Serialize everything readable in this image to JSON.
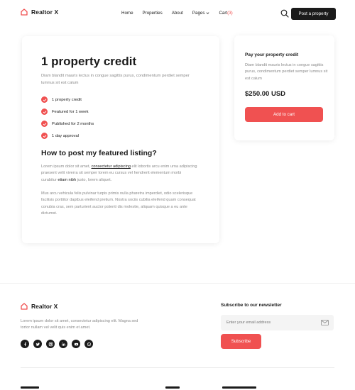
{
  "header": {
    "logo_text": "Realtor X",
    "nav": [
      "Home",
      "Properties",
      "About",
      "Pages"
    ],
    "cart_label": "Cart",
    "cart_count": "(3)",
    "cta": "Post a property"
  },
  "main": {
    "title": "1 property credit",
    "description": "Diam blandit mauris lectus in congue sagittis purus, condimentum  perdiet semper lumnus sit est calum",
    "features": [
      "1 property credit",
      "Featured for 1 week",
      "Published for 2 months",
      "1 day approval"
    ],
    "how_title": "How to post my featured listing?",
    "para1_a": "Lorem ipsum dolor sit amet, ",
    "para1_link": "consectetur adipiscing",
    "para1_b": " elit lobortis arcu enim urna adipiscing praesent velit viverra sit semper lorem eu cursus vel hendrerit elementum morbi curabitur ",
    "para1_strong": "etiam nibh",
    "para1_c": " justo, lorem aliquet.",
    "para2": "Mus arcu vehicula felis pulvinar turpis primis nulla pharetra imperdiet, odio scelerisque facilisis porttitor dapibus eleifend pretium. Nostra sociis cubilia eleifend quam consequat conubia cras, sem parturient auctor potenti dis molestie, aliquam quisque a eu ante dictumst."
  },
  "side": {
    "title": "Pay your property credit",
    "description": "Diam blandit mauris lectus in congue sagittis purus, condimentum  perdiet semper lumnus sit est calum",
    "price": "$250.00 USD",
    "button": "Add to cart"
  },
  "footer": {
    "logo_text": "Realtor X",
    "description": "Lorem ipsum dolor sit amet, consectetur adipiscing elit. Magna sed tortor nullam vel velit quis enim et amet.",
    "socials": [
      "facebook-icon",
      "twitter-icon",
      "instagram-icon",
      "linkedin-icon",
      "youtube-icon",
      "whatsapp-icon"
    ],
    "newsletter_title": "Subscribe to our newsletter",
    "email_placeholder": "Enter your email address",
    "subscribe": "Subscribe"
  },
  "colors": {
    "accent": "#f05151",
    "dark": "#1b1b1b",
    "muted": "#8a8a8a"
  }
}
